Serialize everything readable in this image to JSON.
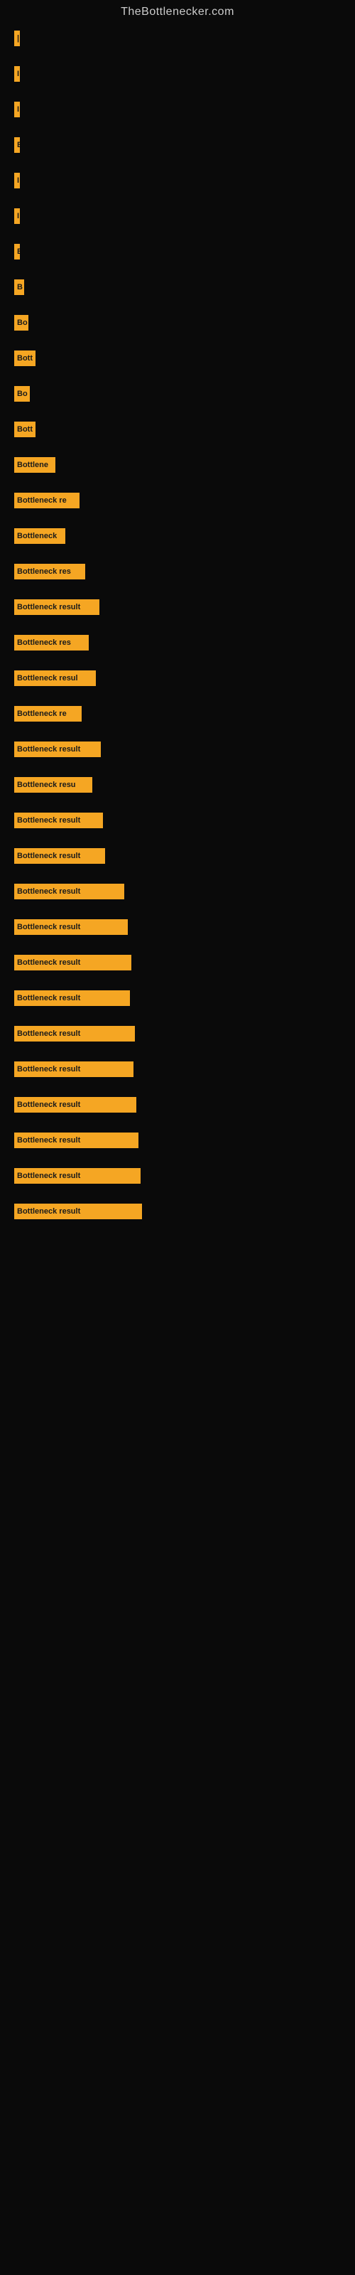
{
  "site": {
    "title": "TheBottlenecker.com"
  },
  "bars": [
    {
      "label": "|",
      "width": 4
    },
    {
      "label": "",
      "height_spacer": true
    },
    {
      "label": "I",
      "width": 4
    },
    {
      "label": "",
      "height_spacer": true
    },
    {
      "label": "I",
      "width": 4
    },
    {
      "label": "",
      "height_spacer": true
    },
    {
      "label": "E",
      "width": 8
    },
    {
      "label": "",
      "height_spacer": true
    },
    {
      "label": "I",
      "width": 5
    },
    {
      "label": "",
      "height_spacer": true
    },
    {
      "label": "I",
      "width": 5
    },
    {
      "label": "",
      "height_spacer": true
    },
    {
      "label": "E",
      "width": 8
    },
    {
      "label": "",
      "height_spacer": true
    },
    {
      "label": "B",
      "width": 14
    },
    {
      "label": "",
      "height_spacer": true
    },
    {
      "label": "Bo",
      "width": 20
    },
    {
      "label": "",
      "height_spacer": true
    },
    {
      "label": "Bott",
      "width": 30
    },
    {
      "label": "",
      "height_spacer": true
    },
    {
      "label": "Bo",
      "width": 22
    },
    {
      "label": "",
      "height_spacer": true
    },
    {
      "label": "Bott",
      "width": 30
    },
    {
      "label": "",
      "height_spacer": true
    },
    {
      "label": "Bottlene",
      "width": 58
    },
    {
      "label": "",
      "height_spacer": true
    },
    {
      "label": "Bottleneck re",
      "width": 92
    },
    {
      "label": "",
      "height_spacer": true
    },
    {
      "label": "Bottleneck",
      "width": 72
    },
    {
      "label": "",
      "height_spacer": true
    },
    {
      "label": "Bottleneck res",
      "width": 100
    },
    {
      "label": "",
      "height_spacer": true
    },
    {
      "label": "Bottleneck result",
      "width": 120
    },
    {
      "label": "",
      "height_spacer": true
    },
    {
      "label": "Bottleneck res",
      "width": 105
    },
    {
      "label": "",
      "height_spacer": true
    },
    {
      "label": "Bottleneck resul",
      "width": 115
    },
    {
      "label": "",
      "height_spacer": true
    },
    {
      "label": "Bottleneck re",
      "width": 95
    },
    {
      "label": "",
      "height_spacer": true
    },
    {
      "label": "Bottleneck result",
      "width": 122
    },
    {
      "label": "",
      "height_spacer": true
    },
    {
      "label": "Bottleneck resu",
      "width": 110
    },
    {
      "label": "",
      "height_spacer": true
    },
    {
      "label": "Bottleneck result",
      "width": 125
    },
    {
      "label": "",
      "height_spacer": true
    },
    {
      "label": "Bottleneck result",
      "width": 128
    },
    {
      "label": "",
      "height_spacer": true
    },
    {
      "label": "Bottleneck result",
      "width": 155
    },
    {
      "label": "",
      "height_spacer": true
    },
    {
      "label": "Bottleneck result",
      "width": 160
    },
    {
      "label": "",
      "height_spacer": true
    },
    {
      "label": "Bottleneck result",
      "width": 165
    },
    {
      "label": "",
      "height_spacer": true
    },
    {
      "label": "Bottleneck result",
      "width": 163
    },
    {
      "label": "",
      "height_spacer": true
    },
    {
      "label": "Bottleneck result",
      "width": 170
    },
    {
      "label": "",
      "height_spacer": true
    },
    {
      "label": "Bottleneck result",
      "width": 168
    },
    {
      "label": "",
      "height_spacer": true
    },
    {
      "label": "Bottleneck result",
      "width": 172
    },
    {
      "label": "",
      "height_spacer": true
    },
    {
      "label": "Bottleneck result",
      "width": 175
    },
    {
      "label": "",
      "height_spacer": true
    },
    {
      "label": "Bottleneck result",
      "width": 178
    },
    {
      "label": "",
      "height_spacer": true
    },
    {
      "label": "Bottleneck result",
      "width": 180
    }
  ]
}
